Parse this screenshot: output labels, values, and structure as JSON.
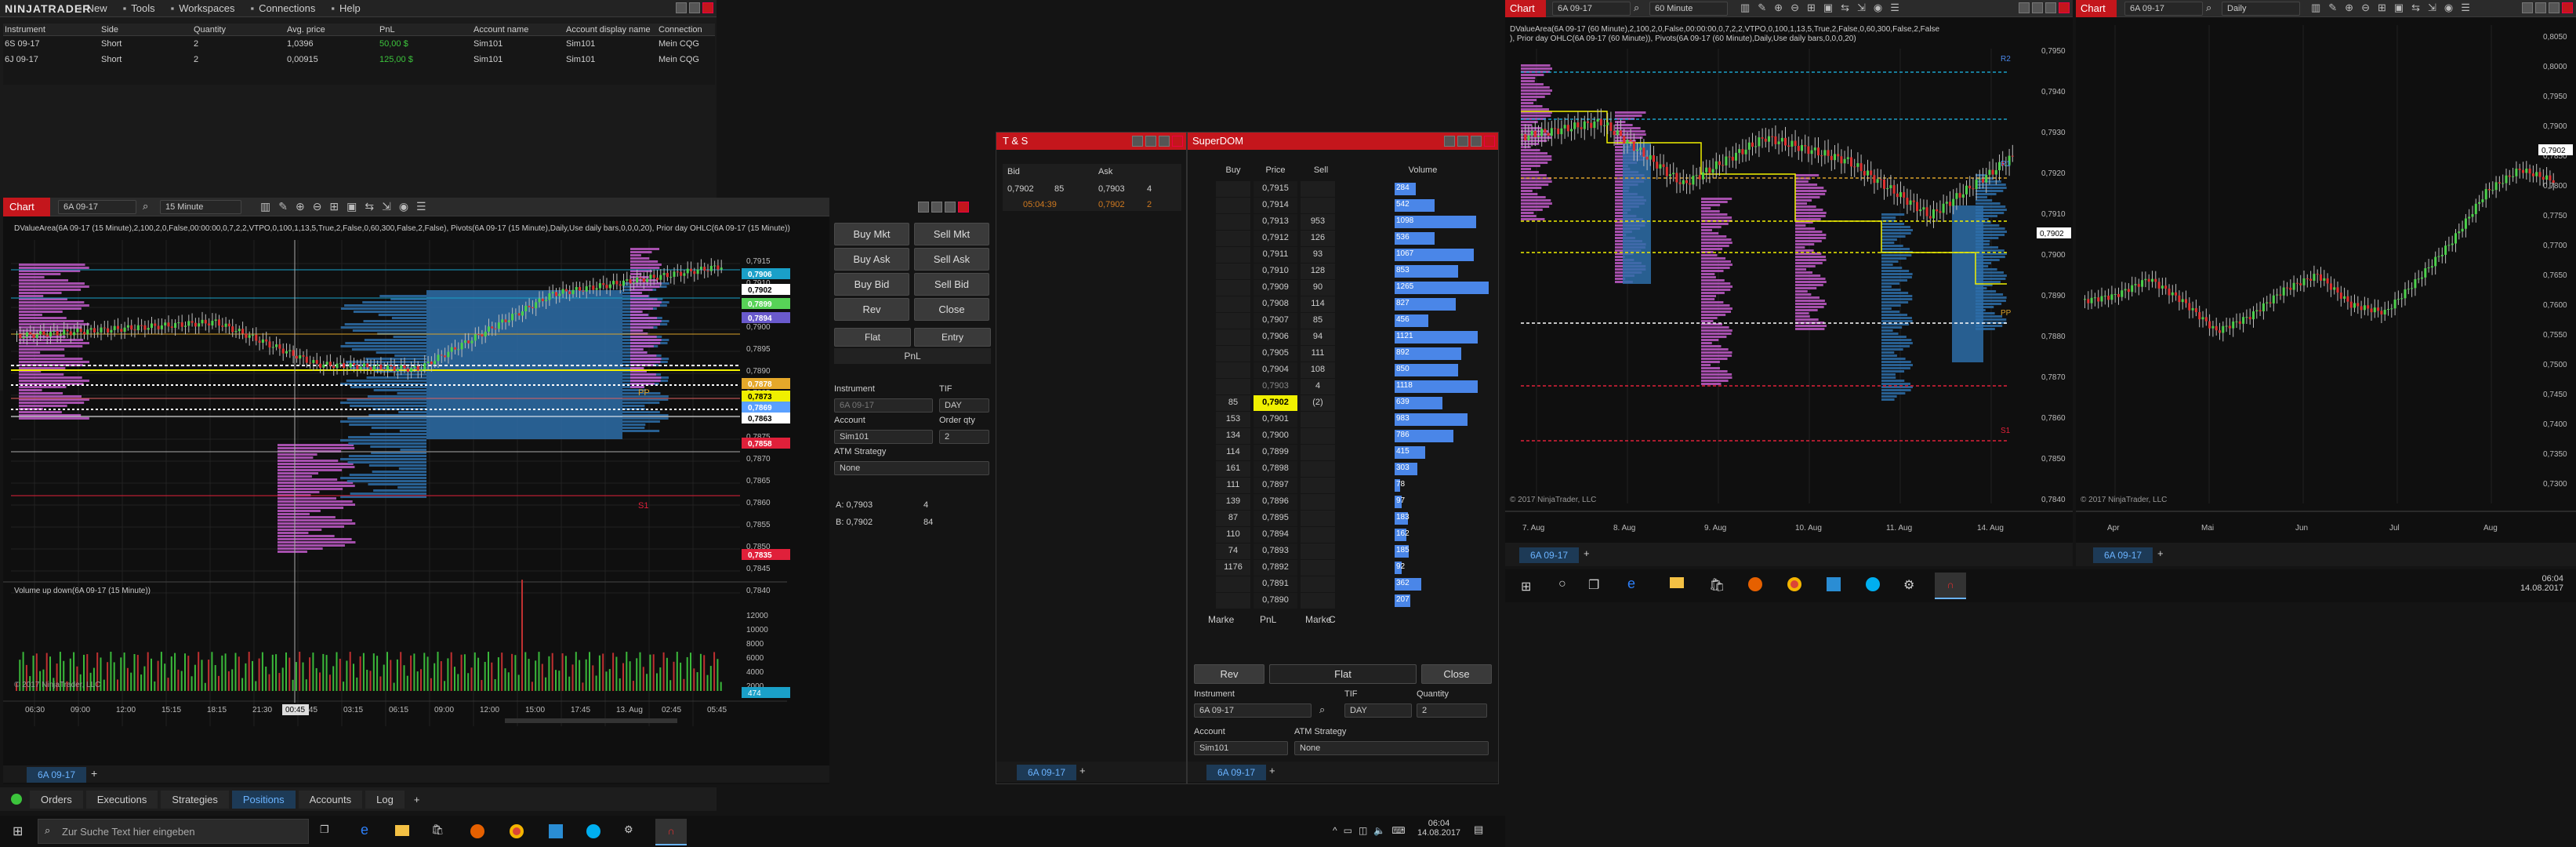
{
  "app": {
    "logo": "NINJATRADER",
    "menu": [
      "New",
      "Tools",
      "Workspaces",
      "Connections",
      "Help"
    ]
  },
  "positions": {
    "headers": [
      "Instrument",
      "Side",
      "Quantity",
      "Avg. price",
      "PnL",
      "Account name",
      "Account display name",
      "Connection"
    ],
    "rows": [
      [
        "6S 09-17",
        "Short",
        "2",
        "1,0396",
        "50,00 $",
        "Sim101",
        "Sim101",
        "Mein CQG"
      ],
      [
        "6J 09-17",
        "Short",
        "2",
        "0,00915",
        "125,00 $",
        "Sim101",
        "Sim101",
        "Mein CQG"
      ]
    ],
    "tabs": [
      "Orders",
      "Executions",
      "Strategies",
      "Positions",
      "Accounts",
      "Log"
    ],
    "active_tab": "Positions"
  },
  "chart1": {
    "label": "Chart",
    "instrument": "6A 09-17",
    "interval": "15 Minute",
    "title": "DValueArea(6A 09-17 (15 Minute),2,100,2,0,False,00:00:00,0,7,2,2,VTPO,0,100,1,13,5,True,2,False,0,60,300,False,2,False), Pivots(6A 09-17 (15 Minute),Daily,Use daily bars,0,0,0,20), Prior day OHLC(6A 09-17 (15 Minute))",
    "volume_title": "Volume up down(6A 09-17 (15 Minute))",
    "copyright": "© 2017 NinjaTrader, LLC",
    "tab": "6A 09-17",
    "price_ticks": [
      "0,7915",
      "0,7910",
      "0,7905",
      "0,7900",
      "0,7895",
      "0,7890",
      "0,7885",
      "0,7880",
      "0,7875",
      "0,7870",
      "0,7865",
      "0,7860",
      "0,7855",
      "0,7850",
      "0,7845",
      "0,7840"
    ],
    "price_flags": [
      {
        "v": "0,7906",
        "c": "#1aa0c8"
      },
      {
        "v": "0,7902",
        "c": "#ffffff",
        "fg": "#000"
      },
      {
        "v": "0,7899",
        "c": "#57d357"
      },
      {
        "v": "0,7894",
        "c": "#6a5acd"
      },
      {
        "v": "0,7878",
        "c": "#e5a82a"
      },
      {
        "v": "0,7873",
        "c": "#f0f000",
        "fg": "#000"
      },
      {
        "v": "0,7869",
        "c": "#5aa0ff"
      },
      {
        "v": "0,7863",
        "c": "#ffffff",
        "fg": "#000"
      },
      {
        "v": "0,7858",
        "c": "#e0203a"
      },
      {
        "v": "0,7835",
        "c": "#e0203a"
      }
    ],
    "vol_ticks": [
      "12000",
      "10000",
      "8000",
      "6000",
      "4000",
      "2000"
    ],
    "vol_flag": "474",
    "time_ticks": [
      "06:30",
      "09:00",
      "12:00",
      "15:15",
      "18:15",
      "21:30",
      "00:45",
      "03:15",
      "06:15",
      "09:00",
      "12:00",
      "15:00",
      "17:45",
      "13. Aug",
      "02:45",
      "05:45"
    ],
    "cursor_time": "00:45",
    "labels": {
      "pp": "PP",
      "s1": "S1"
    }
  },
  "chart_trader": {
    "buttons": [
      "Buy Mkt",
      "Sell Mkt",
      "Buy Ask",
      "Sell Ask",
      "Buy Bid",
      "Sell Bid",
      "Rev",
      "Close"
    ],
    "flat": "Flat",
    "entry": "Entry",
    "pnl": "PnL",
    "instrument_label": "Instrument",
    "instrument": "6A 09-17",
    "tif_label": "TIF",
    "tif": "DAY",
    "account_label": "Account",
    "account": "Sim101",
    "qty_label": "Order qty",
    "qty": "2",
    "atm_label": "ATM Strategy",
    "atm": "None",
    "ask": "A: 0,7903",
    "ask_size": "4",
    "bid": "B: 0,7902",
    "bid_size": "84"
  },
  "ts": {
    "title": "T & S",
    "bid_h": "Bid",
    "ask_h": "Ask",
    "bid": "0,7902",
    "bid_size": "85",
    "ask": "0,7903",
    "ask_size": "4",
    "time": "05:04:39",
    "last": "0,7902",
    "last_size": "2",
    "tab": "6A 09-17"
  },
  "superdom": {
    "title": "SuperDOM",
    "headers": [
      "Buy",
      "Price",
      "Sell",
      "Volume"
    ],
    "rows": [
      {
        "buy": "",
        "p": "0,7915",
        "sell": "",
        "vol": "284"
      },
      {
        "buy": "",
        "p": "0,7914",
        "sell": "",
        "vol": "542"
      },
      {
        "buy": "",
        "p": "0,7913",
        "sell": "953",
        "vol": "1098"
      },
      {
        "buy": "",
        "p": "0,7912",
        "sell": "126",
        "vol": "536"
      },
      {
        "buy": "",
        "p": "0,7911",
        "sell": "93",
        "vol": "1067"
      },
      {
        "buy": "",
        "p": "0,7910",
        "sell": "128",
        "vol": "853"
      },
      {
        "buy": "",
        "p": "0,7909",
        "sell": "90",
        "vol": "1265"
      },
      {
        "buy": "",
        "p": "0,7908",
        "sell": "114",
        "vol": "827"
      },
      {
        "buy": "",
        "p": "0,7907",
        "sell": "85",
        "vol": "456"
      },
      {
        "buy": "",
        "p": "0,7906",
        "sell": "94",
        "vol": "1121"
      },
      {
        "buy": "",
        "p": "0,7905",
        "sell": "111",
        "vol": "892"
      },
      {
        "buy": "",
        "p": "0,7904",
        "sell": "108",
        "vol": "850"
      },
      {
        "buy": "",
        "p": "0,7903",
        "sell": "4",
        "vol": "1118"
      },
      {
        "buy": "85",
        "p": "0,7902",
        "sell": "(2)",
        "vol": "639"
      },
      {
        "buy": "153",
        "p": "0,7901",
        "sell": "",
        "vol": "983"
      },
      {
        "buy": "134",
        "p": "0,7900",
        "sell": "",
        "vol": "786"
      },
      {
        "buy": "114",
        "p": "0,7899",
        "sell": "",
        "vol": "415"
      },
      {
        "buy": "161",
        "p": "0,7898",
        "sell": "",
        "vol": "303"
      },
      {
        "buy": "111",
        "p": "0,7897",
        "sell": "",
        "vol": "78"
      },
      {
        "buy": "139",
        "p": "0,7896",
        "sell": "",
        "vol": "97"
      },
      {
        "buy": "87",
        "p": "0,7895",
        "sell": "",
        "vol": "183"
      },
      {
        "buy": "110",
        "p": "0,7894",
        "sell": "",
        "vol": "162"
      },
      {
        "buy": "74",
        "p": "0,7893",
        "sell": "",
        "vol": "185"
      },
      {
        "buy": "1176",
        "p": "0,7892",
        "sell": "",
        "vol": "92"
      },
      {
        "buy": "",
        "p": "0,7891",
        "sell": "",
        "vol": "362"
      },
      {
        "buy": "",
        "p": "0,7890",
        "sell": "",
        "vol": "207"
      }
    ],
    "bottom": [
      "Marke",
      "PnL",
      "Marke",
      "C"
    ],
    "rev": "Rev",
    "flat": "Flat",
    "close": "Close",
    "instrument_label": "Instrument",
    "instrument": "6A 09-17",
    "tif_label": "TIF",
    "tif": "DAY",
    "qty_label": "Quantity",
    "qty": "2",
    "account_label": "Account",
    "account": "Sim101",
    "atm_label": "ATM Strategy",
    "atm": "None",
    "tab": "6A 09-17"
  },
  "chart2": {
    "label": "Chart",
    "instrument": "6A 09-17",
    "interval": "60 Minute",
    "title": "DValueArea(6A 09-17 (60 Minute),2,100,2,0,False,00:00:00,0,7,2,2,VTPO,0,100,1,13,5,True,2,False,0,60,300,False,2,False), Prior day OHLC(6A 09-17 (60 Minute)), Pivots(6A 09-17 (60 Minute),Daily,Use daily bars,0,0,0,20)",
    "price_ticks": [
      "0,7950",
      "0,7940",
      "0,7930",
      "0,7920",
      "0,7910",
      "0,7900",
      "0,7890",
      "0,7880",
      "0,7870",
      "0,7860",
      "0,7850",
      "0,7840"
    ],
    "price_flag": "0,7902",
    "labels": [
      "R2",
      "R1",
      "PP",
      "S1"
    ],
    "time_ticks": [
      "7. Aug",
      "8. Aug",
      "9. Aug",
      "10. Aug",
      "11. Aug",
      "14. Aug"
    ],
    "copyright": "© 2017 NinjaTrader, LLC",
    "tab": "6A 09-17"
  },
  "chart3": {
    "label": "Chart",
    "instrument": "6A 09-17",
    "interval": "Daily",
    "price_ticks": [
      "0,8050",
      "0,8000",
      "0,7950",
      "0,7900",
      "0,7850",
      "0,7800",
      "0,7750",
      "0,7700",
      "0,7650",
      "0,7600",
      "0,7550",
      "0,7500",
      "0,7450",
      "0,7400",
      "0,7350",
      "0,7300"
    ],
    "price_flag": "0,7902",
    "time_ticks": [
      "Apr",
      "Mai",
      "Jun",
      "Jul",
      "Aug"
    ],
    "copyright": "© 2017 NinjaTrader, LLC",
    "tab": "6A 09-17"
  },
  "taskbar": {
    "search": "Zur Suche Text hier eingeben",
    "time": "06:04",
    "date": "14.08.2017"
  }
}
